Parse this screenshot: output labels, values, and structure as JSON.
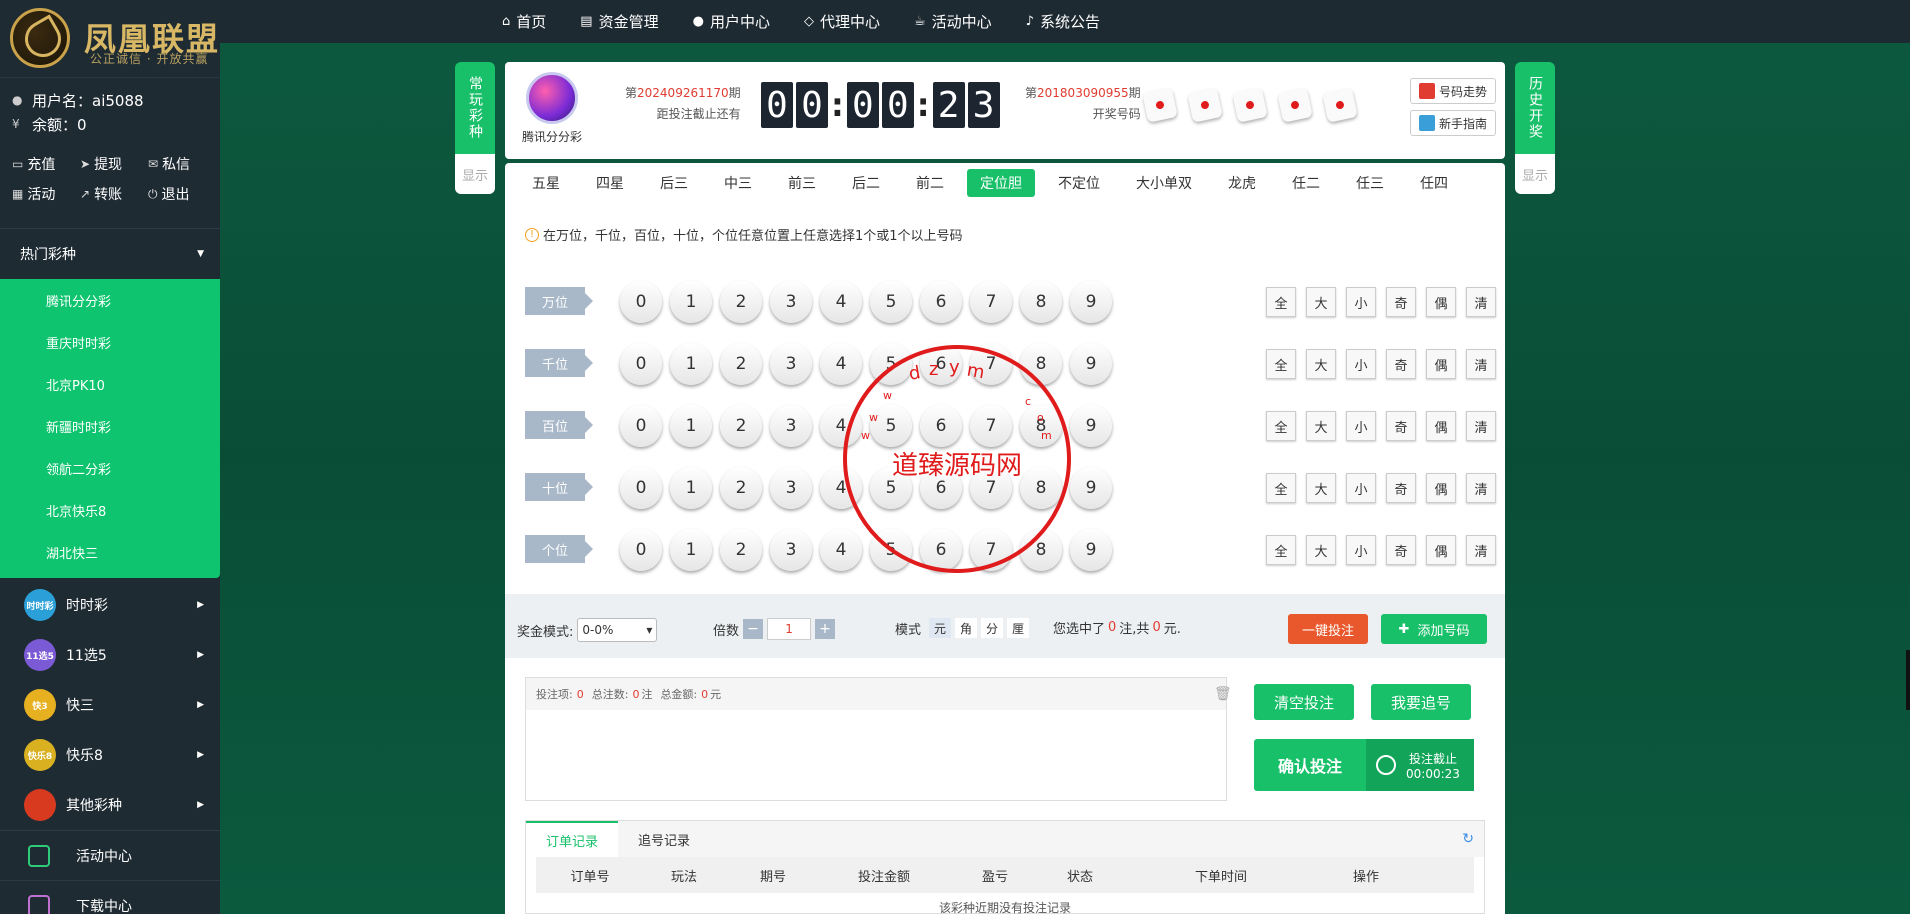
{
  "brand": {
    "title": "凤凰联盟",
    "slogan": "公正诚信 · 开放共赢"
  },
  "user": {
    "name_label": "用户名：ai5088",
    "balance_label": "余额：0"
  },
  "user_actions": [
    {
      "icon": "card-icon",
      "label": "充值"
    },
    {
      "icon": "send-icon",
      "label": "提现"
    },
    {
      "icon": "mail-icon",
      "label": "私信"
    },
    {
      "icon": "calendar-icon",
      "label": "活动"
    },
    {
      "icon": "chart-icon",
      "label": "转账"
    },
    {
      "icon": "power-icon",
      "label": "退出"
    }
  ],
  "hot": {
    "title": "热门彩种",
    "items": [
      "腾讯分分彩",
      "重庆时时彩",
      "北京PK10",
      "新疆时时彩",
      "领航二分彩",
      "北京快乐8",
      "湖北快三"
    ]
  },
  "categories": [
    {
      "label": "时时彩",
      "color": "#2a9fd8",
      "badge": "时时彩"
    },
    {
      "label": "11选5",
      "color": "#7b5ad6",
      "badge": "11选5"
    },
    {
      "label": "快三",
      "color": "#e6b020",
      "badge": "快3"
    },
    {
      "label": "快乐8",
      "color": "#d8b020",
      "badge": "快乐8"
    },
    {
      "label": "其他彩种",
      "color": "#d83a20",
      "badge": ""
    }
  ],
  "extras": [
    {
      "label": "活动中心",
      "icon": "gift-icon"
    },
    {
      "label": "下载中心",
      "icon": "download-icon"
    }
  ],
  "nav": [
    {
      "icon": "home-icon",
      "glyph": "⌂",
      "label": "首页"
    },
    {
      "icon": "money-icon",
      "glyph": "▤",
      "label": "资金管理"
    },
    {
      "icon": "user-icon",
      "glyph": "●",
      "label": "用户中心"
    },
    {
      "icon": "diamond-icon",
      "glyph": "◇",
      "label": "代理中心"
    },
    {
      "icon": "cup-icon",
      "glyph": "☕",
      "label": "活动中心"
    },
    {
      "icon": "bell-icon",
      "glyph": "♪",
      "label": "系统公告"
    }
  ],
  "side_left": {
    "label": "常玩彩种",
    "sub": "显示"
  },
  "side_right": {
    "label": "历史开奖",
    "sub": "显示"
  },
  "game": {
    "name": "腾讯分分彩",
    "cur_prefix": "第",
    "cur_period": "202409261170",
    "cur_suffix": "期",
    "cur_note": "距投注截止还有",
    "timer": [
      "0",
      "0",
      ":",
      "0",
      "0",
      ":",
      "2",
      "3"
    ],
    "last_prefix": "第",
    "last_period": "201803090955",
    "last_suffix": "期",
    "last_note": "开奖号码",
    "trend": "号码走势",
    "guide": "新手指南"
  },
  "play_tabs": [
    "五星",
    "四星",
    "后三",
    "中三",
    "前三",
    "后二",
    "前二",
    "定位胆",
    "不定位",
    "大小单双",
    "龙虎",
    "任二",
    "任三",
    "任四"
  ],
  "active_tab": "定位胆",
  "tip": "在万位，千位，百位，十位，个位任意位置上任意选择1个或1个以上号码",
  "rows": [
    {
      "label": "万位"
    },
    {
      "label": "千位"
    },
    {
      "label": "百位"
    },
    {
      "label": "十位"
    },
    {
      "label": "个位"
    }
  ],
  "balls": [
    "0",
    "1",
    "2",
    "3",
    "4",
    "5",
    "6",
    "7",
    "8",
    "9"
  ],
  "filters": [
    "全",
    "大",
    "小",
    "奇",
    "偶",
    "清"
  ],
  "bet": {
    "prize_label": "奖金模式:",
    "prize_value": "0-0%",
    "mult_label": "倍数",
    "mult_value": "1",
    "mode_label": "模式",
    "modes": [
      "元",
      "角",
      "分",
      "厘"
    ],
    "summary_a": "您选中了",
    "summary_count": "0",
    "summary_b": "注,共",
    "summary_amount": "0",
    "summary_c": "元.",
    "quick": "一键投注",
    "add": "添加号码"
  },
  "cart": {
    "items_label": "投注项:",
    "items": "0",
    "notes_label": "总注数:",
    "notes": "0",
    "notes_unit": "注",
    "amount_label": "总金额:",
    "amount": "0",
    "amount_unit": "元"
  },
  "actions": {
    "clear": "清空投注",
    "chase": "我要追号",
    "confirm": "确认投注",
    "deadline": "投注截止",
    "deadline_time": "00:00:23"
  },
  "orders": {
    "tabs": [
      "订单记录",
      "追号记录"
    ],
    "cols": [
      "订单号",
      "玩法",
      "期号",
      "投注金额",
      "盈亏",
      "状态",
      "下单时间",
      "操作"
    ],
    "empty": "该彩种近期没有投注记录"
  },
  "seal": {
    "text": "道臻源码网",
    "ring_top": "dzym",
    "ring_letters": [
      "w",
      "w",
      "w",
      "c",
      "o",
      "m"
    ]
  }
}
